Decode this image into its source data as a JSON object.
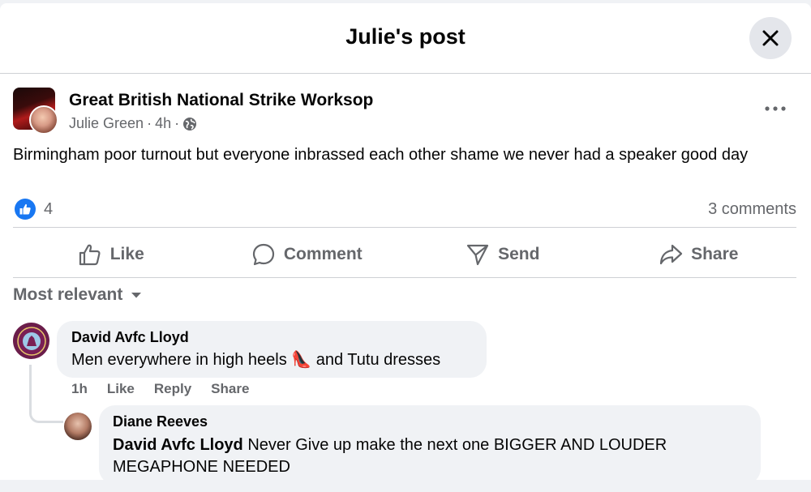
{
  "header": {
    "title": "Julie's post",
    "close_icon": "close-icon"
  },
  "post": {
    "group_name": "Great British National Strike Worksop",
    "author": "Julie Green",
    "time": "4h",
    "separator": "·",
    "privacy_icon": "globe-icon",
    "more_icon": "more-horizontal-icon",
    "text": "Birmingham poor turnout but everyone inbrassed each other shame we never had a speaker good day",
    "like_count": "4",
    "comment_count": "3 comments"
  },
  "actions": [
    {
      "label": "Like",
      "icon": "thumbs-up-icon"
    },
    {
      "label": "Comment",
      "icon": "speech-bubble-icon"
    },
    {
      "label": "Send",
      "icon": "send-icon"
    },
    {
      "label": "Share",
      "icon": "share-arrow-icon"
    }
  ],
  "sort": {
    "label": "Most relevant",
    "icon": "caret-down-icon"
  },
  "comments": [
    {
      "author": "David Avfc Lloyd",
      "text_before": "Men everywhere in high heels ",
      "emoji": "👠",
      "text_after": " and Tutu dresses",
      "time": "1h",
      "like": "Like",
      "reply": "Reply",
      "share": "Share"
    },
    {
      "author": "Diane Reeves",
      "mention": "David Avfc Lloyd",
      "text": " Never Give up make the next one BIGGER AND LOUDER MEGAPHONE NEEDED"
    }
  ],
  "colors": {
    "accent": "#1877f2",
    "secondary_text": "#65676b",
    "bubble": "#f0f2f5"
  }
}
